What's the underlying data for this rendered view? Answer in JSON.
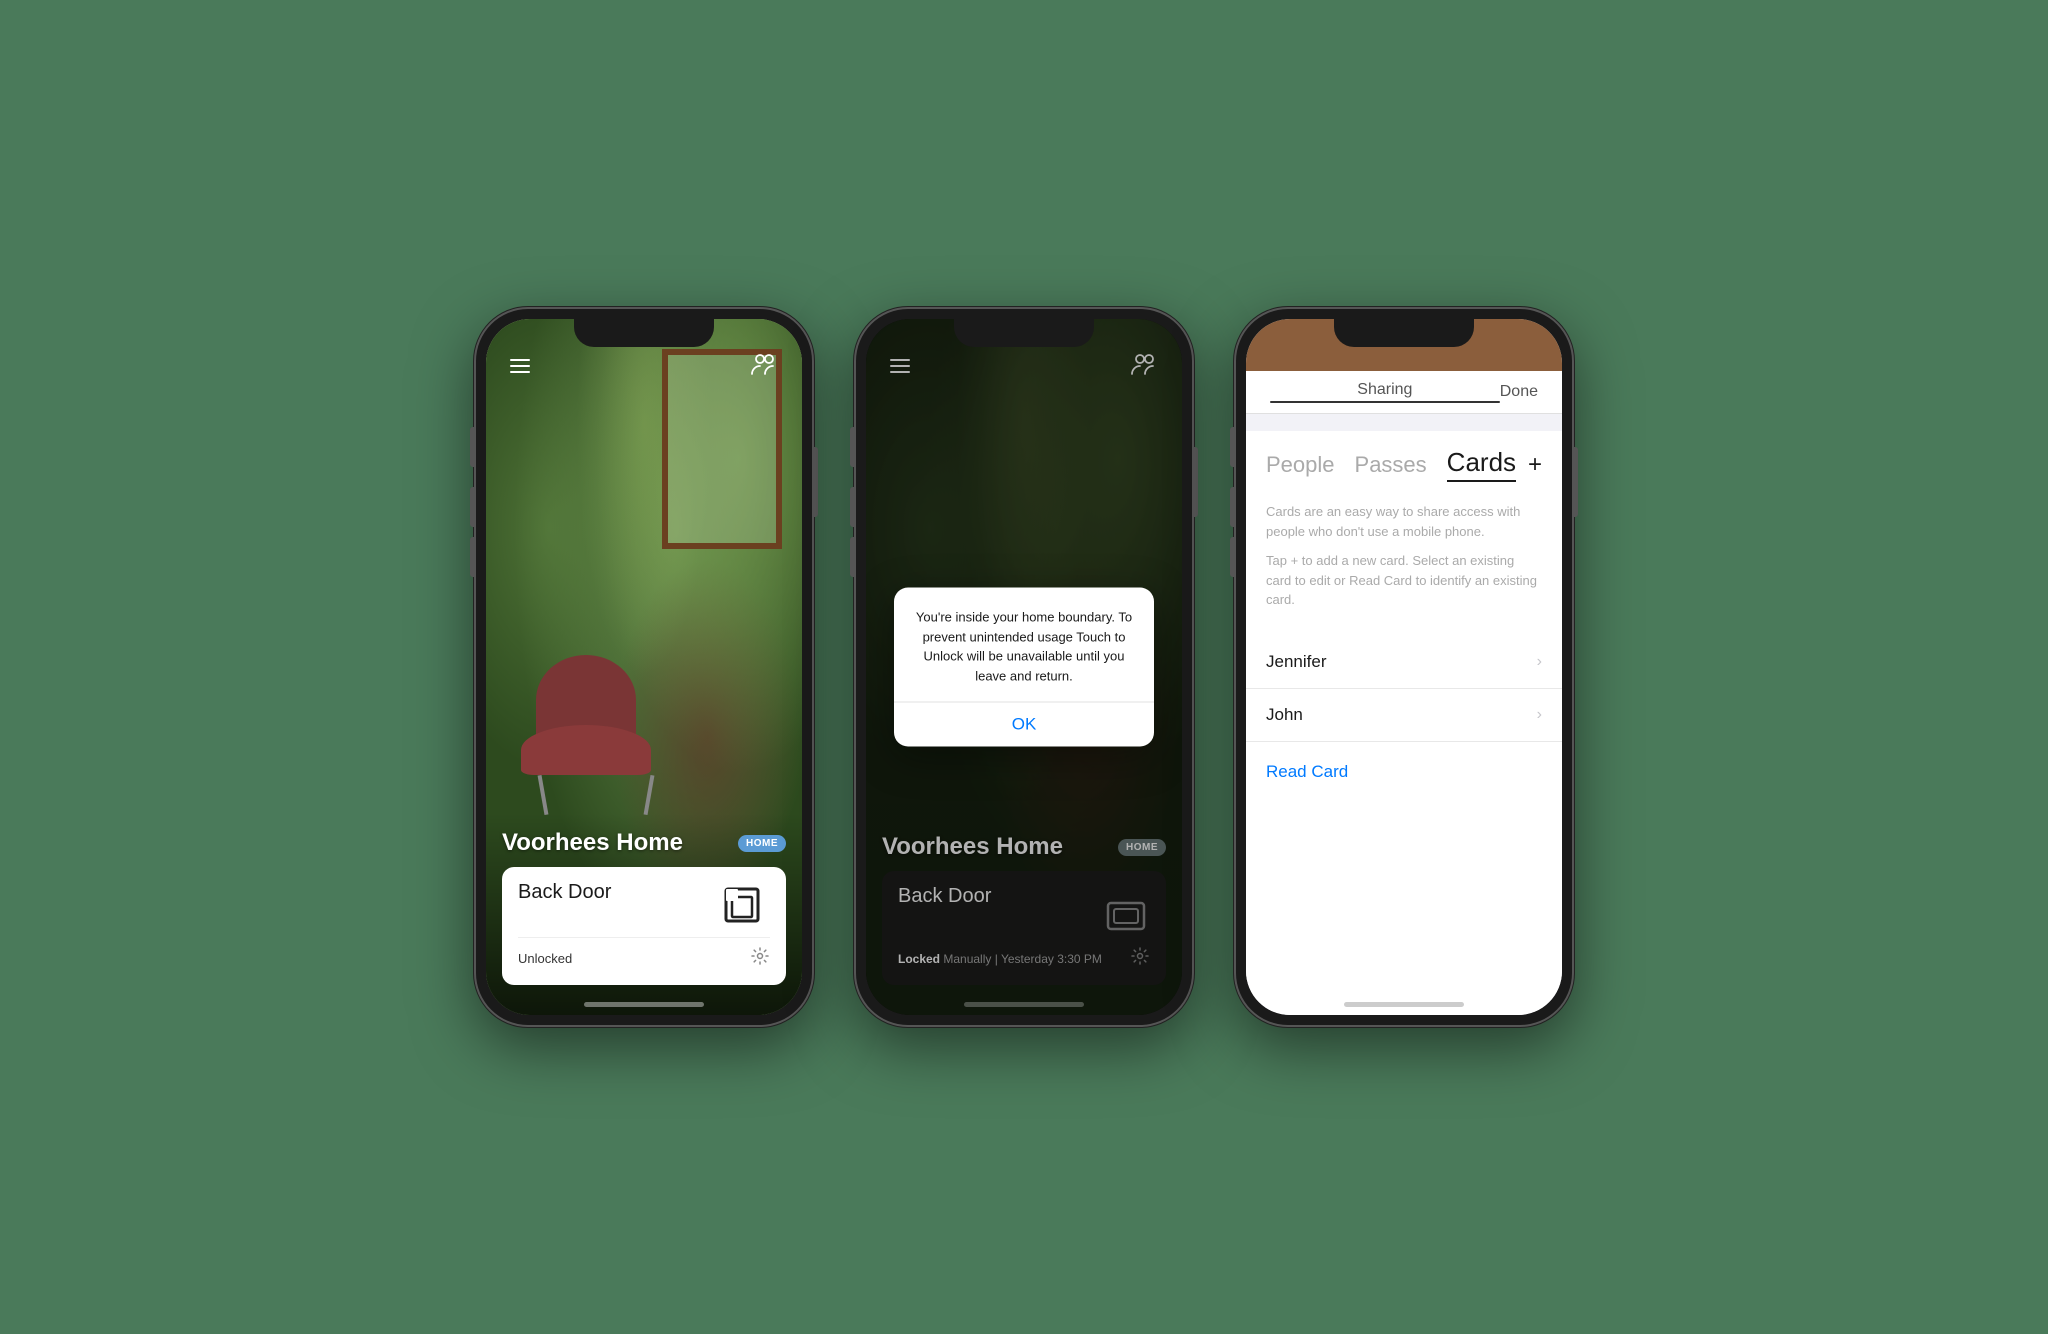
{
  "background_color": "#4a7a5a",
  "phone1": {
    "location_name": "Voorhees Home",
    "home_badge": "HOME",
    "door_name": "Back Door",
    "door_status": "Unlocked",
    "hamburger_label": "menu",
    "people_icon_label": "people"
  },
  "phone2": {
    "location_name": "Voorhees Home",
    "home_badge": "HOME",
    "door_name": "Back Door",
    "door_status_prefix": "Locked",
    "door_status_detail": "Manually | Yesterday  3:30 PM",
    "dialog_message": "You're inside your home boundary. To prevent unintended usage Touch to Unlock will be unavailable until you leave and return.",
    "dialog_ok": "OK"
  },
  "phone3": {
    "header_label": "Sharing",
    "done_label": "Done",
    "tab_people": "People",
    "tab_passes": "Passes",
    "tab_cards": "Cards",
    "tab_plus": "+",
    "description_line1": "Cards are an easy way to share access with people who don't use a mobile phone.",
    "description_line2": "Tap + to add a new card. Select an existing card to edit or Read Card to identify an existing card.",
    "card_item_1": "Jennifer",
    "card_item_2": "John",
    "read_card_label": "Read Card"
  }
}
